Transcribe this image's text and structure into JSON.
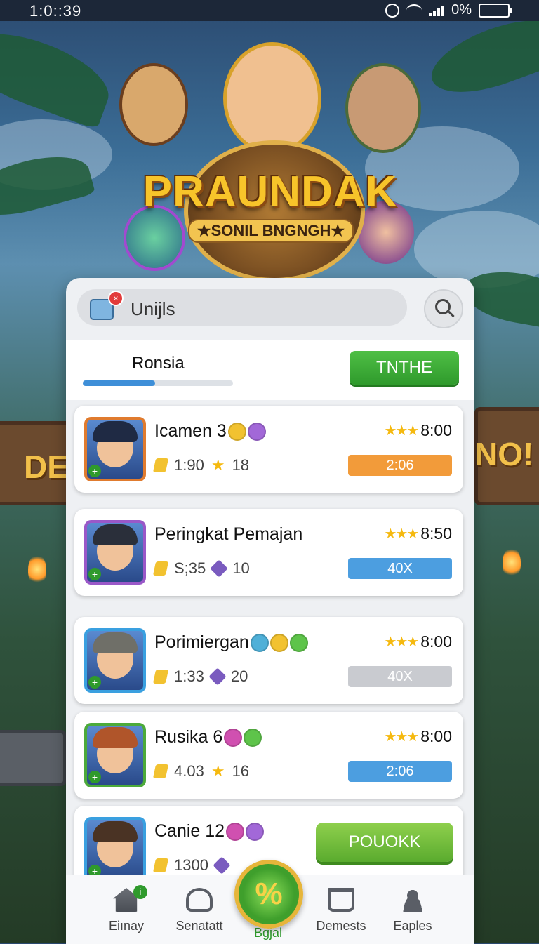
{
  "status_bar": {
    "time": "1:0::39",
    "battery": "0%"
  },
  "hero": {
    "title": "PRAUNDAK",
    "subtitle": "★SONIL BNGNGH★",
    "sign_left": "DE.",
    "sign_right": "NO!"
  },
  "search": {
    "value": "Unijls",
    "badge": "×"
  },
  "filter": {
    "label": "Ronsia",
    "progress_percent": 48,
    "button_label": "TNTHE"
  },
  "players": [
    {
      "name": "Icamen  3",
      "stat1": "1:90",
      "stat2": "18",
      "stat2_icon": "star-icon",
      "rating": "8:00",
      "tag": "2:06",
      "tag_color": "orange",
      "avatar_border": "#e07b2e",
      "hair": "#1f2a44",
      "coins": [
        "#f2c230",
        "#a268d8"
      ]
    },
    {
      "name": "Peringkat Pemajan",
      "stat1": "S;35",
      "stat2": "10",
      "stat2_icon": "cube-icon",
      "rating": "8:50",
      "tag": "40X",
      "tag_color": "blue",
      "avatar_border": "#9a58c8",
      "hair": "#2a2f3a",
      "coins": []
    },
    {
      "name": "Porimiergan",
      "stat1": "1:33",
      "stat2": "20",
      "stat2_icon": "cube-icon",
      "rating": "8:00",
      "tag": "40X",
      "tag_color": "gray",
      "avatar_border": "#3aa0e0",
      "hair": "#6f6f68",
      "coins": [
        "#4fb0d8",
        "#f2c230",
        "#5ec44a"
      ]
    },
    {
      "name": "Rusika   6",
      "stat1": "4.03",
      "stat2": "16",
      "stat2_icon": "star-icon",
      "rating": "8:00",
      "tag": "2:06",
      "tag_color": "blue",
      "avatar_border": "#4caa3a",
      "hair": "#b0552a",
      "coins": [
        "#d050b0",
        "#5ec44a"
      ]
    },
    {
      "name": "Canie 12",
      "stat1": "1300",
      "stat2": "",
      "stat2_icon": "cube-icon",
      "rating": "",
      "tag": "",
      "tag_color": "",
      "avatar_border": "#3aa0e0",
      "hair": "#4a3324",
      "coins": [
        "#d050b0",
        "#a268d8"
      ],
      "button_label": "POUOKK"
    }
  ],
  "nav": {
    "items": [
      {
        "label": "Eiınay",
        "icon": "home-icon",
        "badge": "i"
      },
      {
        "label": "Senatatt",
        "icon": "profile-icon"
      },
      {
        "label": "Bgjal",
        "icon": "percent-icon",
        "fab": "%"
      },
      {
        "label": "Demests",
        "icon": "cart-icon"
      },
      {
        "label": "Eaples",
        "icon": "user-icon"
      }
    ]
  },
  "colors": {
    "accent_green": "#2f9a2c",
    "accent_blue": "#3e8fd8",
    "accent_orange": "#f29b3a",
    "gold": "#f7c42a"
  }
}
